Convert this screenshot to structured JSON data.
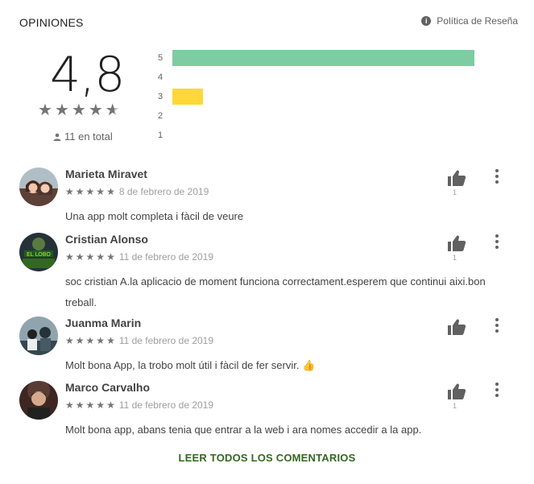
{
  "header": {
    "title": "OPINIONES",
    "policy_label": "Política de Reseña",
    "policy_icon": "info-icon"
  },
  "summary": {
    "score": "4,8",
    "rating_value": 4.8,
    "total_label": "11 en total",
    "histogram": [
      {
        "label": "5",
        "fraction": 1.0,
        "color": "#7ecca1"
      },
      {
        "label": "4",
        "fraction": 0.0,
        "color": "#b3d98b"
      },
      {
        "label": "3",
        "fraction": 0.1,
        "color": "#ffd738"
      },
      {
        "label": "2",
        "fraction": 0.0,
        "color": "#ffb235"
      },
      {
        "label": "1",
        "fraction": 0.0,
        "color": "#ff8c5a"
      }
    ]
  },
  "reviews": [
    {
      "name": "Marieta Miravet",
      "date": "8 de febrero de 2019",
      "text": "Una app molt completa i fàcil de veure",
      "likes": "1",
      "stars": 5
    },
    {
      "name": "Cristian Alonso",
      "date": "11 de febrero de 2019",
      "text": "soc cristian A.la aplicacio de moment funciona correctament.esperem que continui aixi.bon treball.",
      "likes": "1",
      "stars": 5
    },
    {
      "name": "Juanma Marin",
      "date": "11 de febrero de 2019",
      "text": "Molt bona App, la trobo molt útil i fàcil de fer servir. 👍",
      "likes": "",
      "stars": 5
    },
    {
      "name": "Marco Carvalho",
      "date": "11 de febrero de 2019",
      "text": "Molt bona app, abans tenia que entrar a la web i ara nomes accedir a la app.",
      "likes": "1",
      "stars": 5
    }
  ],
  "footer": {
    "read_all_label": "LEER TODOS LOS COMENTARIOS"
  },
  "colors": {
    "accent_link": "#33691e"
  }
}
